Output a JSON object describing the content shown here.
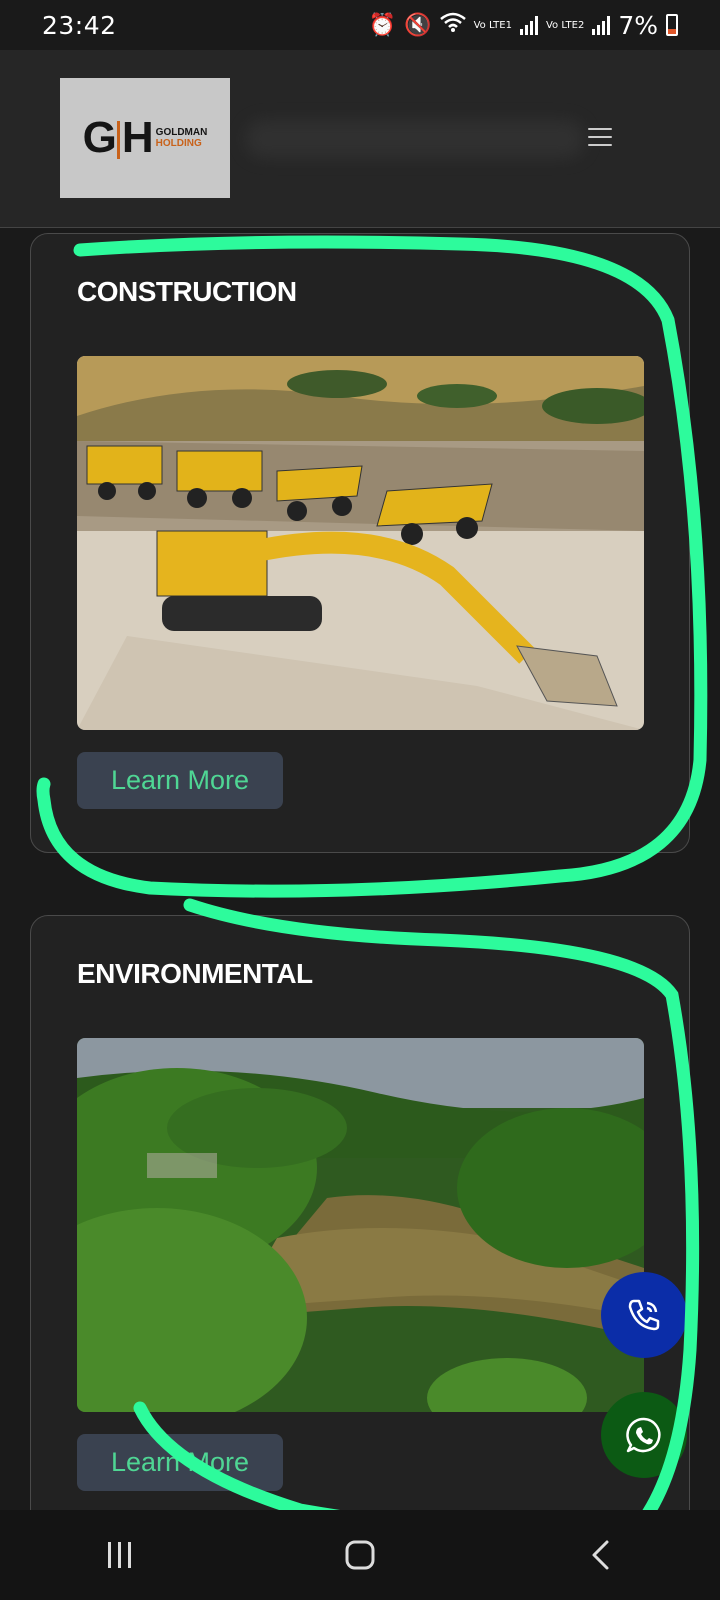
{
  "status_bar": {
    "time": "23:42",
    "network_1": "Vo LTE1",
    "network_2": "Vo LTE2",
    "battery": "7%"
  },
  "header": {
    "logo": {
      "mark": "GH",
      "line1": "GOLDMAN",
      "line2": "HOLDING"
    },
    "menu_icon": "hamburger-menu-icon"
  },
  "cards": [
    {
      "title": "CONSTRUCTION",
      "image": "construction-equipment-photo",
      "button": "Learn More"
    },
    {
      "title": "ENVIRONMENTAL",
      "image": "river-forest-photo",
      "button": "Learn More"
    }
  ],
  "floating_actions": [
    {
      "icon": "phone-call-icon",
      "color": "#0b2da8"
    },
    {
      "icon": "whatsapp-icon",
      "color": "#0c5a14"
    }
  ],
  "colors": {
    "accent": "#4fd694",
    "button_bg": "#3a4250",
    "annotation": "#2dfb9c",
    "brand_orange": "#c9621a"
  },
  "nav_bar": {
    "icons": [
      "recent-apps-icon",
      "home-icon",
      "back-icon"
    ]
  }
}
